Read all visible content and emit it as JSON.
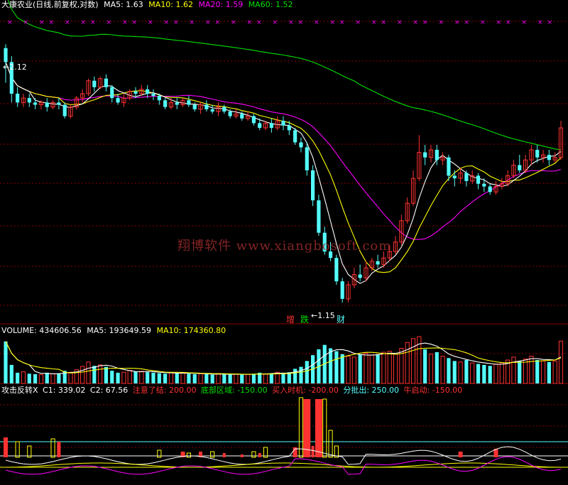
{
  "header": {
    "title": "大康农业(日线,前复权,对数)",
    "ma5": "MA5: 1.63",
    "ma10": "MA10: 1.62",
    "ma20": "MA20: 1.59",
    "ma60": "MA60: 1.52"
  },
  "price_annotations": {
    "high": "2.12",
    "low": "1.15",
    "tag_zeng": "增",
    "tag_die": "跌",
    "tag_cai": "财"
  },
  "watermark": "翔博软件 www.xiangbosoft.com",
  "volume_header": {
    "volume": "VOLUME: 434606.56",
    "ma5": "MA5: 193649.59",
    "ma10": "MA10: 174360.80"
  },
  "indicator_header": {
    "name": "攻击反转X",
    "c1": "C1: 339.02",
    "c2": "C2: 67.56",
    "attention": "注意了结: 200.00",
    "bottom": "底部区域: -150.00",
    "buy": "买入时机: -200.00",
    "sell": "分批出: 250.00",
    "bull": "牛启动: -150.00"
  },
  "colors": {
    "bg": "#000000",
    "up": "#ff3232",
    "down": "#54ffff",
    "ma5": "#ffffff",
    "ma10": "#ffff00",
    "ma20": "#ff00ff",
    "ma60": "#00e000",
    "grid": "#8b0000"
  },
  "chart_data": [
    {
      "type": "candlestick",
      "title": "大康农业(日线,前复权,对数)",
      "scale": "log",
      "ylim": [
        1.1,
        2.3
      ],
      "annotations": [
        "2.12",
        "1.15"
      ],
      "candles": [
        [
          2.12,
          2.05,
          2.14,
          1.95
        ],
        [
          2.05,
          1.9,
          2.08,
          1.86
        ],
        [
          1.9,
          1.86,
          1.93,
          1.84
        ],
        [
          1.86,
          1.88,
          1.9,
          1.84
        ],
        [
          1.88,
          1.86,
          1.9,
          1.84
        ],
        [
          1.86,
          1.85,
          1.88,
          1.83
        ],
        [
          1.85,
          1.86,
          1.87,
          1.83
        ],
        [
          1.86,
          1.84,
          1.88,
          1.82
        ],
        [
          1.84,
          1.86,
          1.87,
          1.83
        ],
        [
          1.86,
          1.85,
          1.88,
          1.83
        ],
        [
          1.85,
          1.8,
          1.86,
          1.79
        ],
        [
          1.8,
          1.84,
          1.85,
          1.79
        ],
        [
          1.84,
          1.88,
          1.89,
          1.83
        ],
        [
          1.88,
          1.9,
          1.92,
          1.86
        ],
        [
          1.9,
          1.96,
          1.97,
          1.89
        ],
        [
          1.96,
          1.93,
          1.98,
          1.91
        ],
        [
          1.93,
          1.97,
          1.98,
          1.92
        ],
        [
          1.97,
          1.93,
          1.99,
          1.91
        ],
        [
          1.93,
          1.88,
          1.94,
          1.86
        ],
        [
          1.88,
          1.86,
          1.9,
          1.85
        ],
        [
          1.86,
          1.88,
          1.9,
          1.84
        ],
        [
          1.88,
          1.91,
          1.92,
          1.87
        ],
        [
          1.91,
          1.9,
          1.93,
          1.88
        ],
        [
          1.9,
          1.92,
          1.94,
          1.89
        ],
        [
          1.92,
          1.9,
          1.94,
          1.88
        ],
        [
          1.9,
          1.89,
          1.92,
          1.87
        ],
        [
          1.89,
          1.87,
          1.9,
          1.85
        ],
        [
          1.87,
          1.84,
          1.88,
          1.83
        ],
        [
          1.84,
          1.86,
          1.88,
          1.83
        ],
        [
          1.86,
          1.85,
          1.88,
          1.83
        ],
        [
          1.85,
          1.87,
          1.88,
          1.84
        ],
        [
          1.87,
          1.85,
          1.89,
          1.84
        ],
        [
          1.85,
          1.83,
          1.86,
          1.82
        ],
        [
          1.83,
          1.85,
          1.86,
          1.81
        ],
        [
          1.85,
          1.83,
          1.87,
          1.82
        ],
        [
          1.83,
          1.82,
          1.85,
          1.81
        ],
        [
          1.82,
          1.84,
          1.86,
          1.8
        ],
        [
          1.84,
          1.82,
          1.85,
          1.81
        ],
        [
          1.82,
          1.8,
          1.83,
          1.79
        ],
        [
          1.8,
          1.81,
          1.83,
          1.79
        ],
        [
          1.81,
          1.79,
          1.82,
          1.78
        ],
        [
          1.79,
          1.8,
          1.82,
          1.78
        ],
        [
          1.8,
          1.77,
          1.81,
          1.76
        ],
        [
          1.77,
          1.75,
          1.79,
          1.74
        ],
        [
          1.75,
          1.77,
          1.78,
          1.74
        ],
        [
          1.77,
          1.75,
          1.79,
          1.73
        ],
        [
          1.75,
          1.78,
          1.8,
          1.74
        ],
        [
          1.78,
          1.76,
          1.8,
          1.74
        ],
        [
          1.76,
          1.74,
          1.78,
          1.72
        ],
        [
          1.74,
          1.69,
          1.75,
          1.68
        ],
        [
          1.69,
          1.67,
          1.71,
          1.65
        ],
        [
          1.67,
          1.58,
          1.69,
          1.56
        ],
        [
          1.58,
          1.47,
          1.6,
          1.45
        ],
        [
          1.47,
          1.36,
          1.49,
          1.35
        ],
        [
          1.36,
          1.3,
          1.38,
          1.29
        ],
        [
          1.3,
          1.28,
          1.33,
          1.27
        ],
        [
          1.28,
          1.21,
          1.29,
          1.2
        ],
        [
          1.21,
          1.16,
          1.22,
          1.15
        ],
        [
          1.16,
          1.2,
          1.21,
          1.15
        ],
        [
          1.2,
          1.23,
          1.25,
          1.19
        ],
        [
          1.23,
          1.22,
          1.26,
          1.21
        ],
        [
          1.22,
          1.25,
          1.27,
          1.21
        ],
        [
          1.25,
          1.27,
          1.28,
          1.24
        ],
        [
          1.27,
          1.26,
          1.29,
          1.25
        ],
        [
          1.26,
          1.28,
          1.3,
          1.25
        ],
        [
          1.28,
          1.3,
          1.32,
          1.27
        ],
        [
          1.3,
          1.33,
          1.35,
          1.29
        ],
        [
          1.33,
          1.4,
          1.42,
          1.32
        ],
        [
          1.4,
          1.46,
          1.48,
          1.39
        ],
        [
          1.46,
          1.55,
          1.58,
          1.45
        ],
        [
          1.55,
          1.65,
          1.72,
          1.54
        ],
        [
          1.65,
          1.63,
          1.68,
          1.6
        ],
        [
          1.63,
          1.66,
          1.68,
          1.61
        ],
        [
          1.66,
          1.62,
          1.68,
          1.6
        ],
        [
          1.62,
          1.63,
          1.65,
          1.6
        ],
        [
          1.63,
          1.56,
          1.64,
          1.54
        ],
        [
          1.56,
          1.55,
          1.58,
          1.52
        ],
        [
          1.55,
          1.57,
          1.59,
          1.53
        ],
        [
          1.57,
          1.54,
          1.58,
          1.52
        ],
        [
          1.54,
          1.56,
          1.58,
          1.53
        ],
        [
          1.56,
          1.53,
          1.57,
          1.51
        ],
        [
          1.53,
          1.52,
          1.55,
          1.5
        ],
        [
          1.52,
          1.5,
          1.53,
          1.49
        ],
        [
          1.5,
          1.52,
          1.54,
          1.49
        ],
        [
          1.52,
          1.53,
          1.55,
          1.51
        ],
        [
          1.53,
          1.56,
          1.58,
          1.52
        ],
        [
          1.56,
          1.6,
          1.62,
          1.55
        ],
        [
          1.6,
          1.58,
          1.64,
          1.57
        ],
        [
          1.58,
          1.62,
          1.64,
          1.57
        ],
        [
          1.62,
          1.66,
          1.68,
          1.6
        ],
        [
          1.66,
          1.63,
          1.68,
          1.61
        ],
        [
          1.63,
          1.64,
          1.66,
          1.61
        ],
        [
          1.64,
          1.62,
          1.66,
          1.6
        ],
        [
          1.62,
          1.63,
          1.65,
          1.61
        ],
        [
          1.63,
          1.75,
          1.78,
          1.62
        ]
      ]
    },
    {
      "type": "bar",
      "title": "VOLUME",
      "values": [
        430,
        190,
        110,
        120,
        100,
        95,
        90,
        110,
        100,
        105,
        130,
        115,
        140,
        175,
        220,
        180,
        190,
        170,
        130,
        110,
        115,
        135,
        120,
        125,
        115,
        110,
        105,
        100,
        110,
        105,
        110,
        100,
        95,
        100,
        95,
        90,
        100,
        95,
        90,
        95,
        90,
        95,
        100,
        110,
        95,
        105,
        115,
        105,
        115,
        150,
        170,
        230,
        290,
        350,
        395,
        360,
        330,
        300,
        280,
        270,
        300,
        310,
        290,
        300,
        320,
        330,
        300,
        360,
        420,
        460,
        480,
        350,
        300,
        320,
        280,
        260,
        230,
        220,
        240,
        210,
        200,
        190,
        180,
        200,
        210,
        240,
        270,
        230,
        250,
        280,
        240,
        230,
        220,
        230,
        434
      ],
      "ma5": "MA5: 193649.59",
      "ma10": "MA10: 174360.80"
    },
    {
      "type": "bar",
      "title": "攻击反转X",
      "series_labels": [
        "C1: 339.02",
        "C2: 67.56",
        "注意了结: 200.00",
        "底部区域: -150.00",
        "买入时机: -200.00",
        "分批出: 250.00",
        "牛启动: -150.00"
      ]
    }
  ]
}
